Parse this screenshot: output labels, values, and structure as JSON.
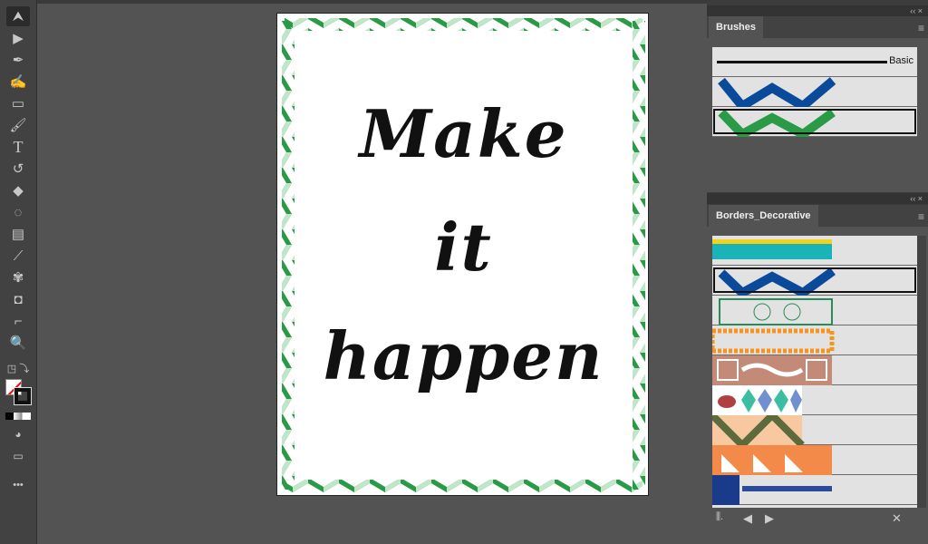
{
  "toolbar": {
    "tools": [
      "selection",
      "direct-selection",
      "pen",
      "curvature",
      "rectangle",
      "paintbrush",
      "type",
      "rotate",
      "eraser",
      "shape-builder",
      "gradient",
      "eyedropper",
      "puppet-warp",
      "blend",
      "artboard",
      "zoom"
    ],
    "more": "•••"
  },
  "artboard": {
    "lines": [
      "Make",
      "it",
      "happen"
    ],
    "border_color": "#2a9a47"
  },
  "brushes_panel": {
    "title": "Brushes",
    "basic_label": "Basic",
    "collapse": "‹‹ ×"
  },
  "borders_panel": {
    "title": "Borders_Decorative",
    "collapse": "‹‹ ×"
  },
  "colors": {
    "blue": "#0a4a9a",
    "green": "#2a9a47",
    "teal": "#1ab3b8",
    "yellow": "#f2d21a",
    "orange": "#f7941d",
    "tan": "#c48a78",
    "salmon": "#f48a4a",
    "olive": "#5c6b3c"
  }
}
